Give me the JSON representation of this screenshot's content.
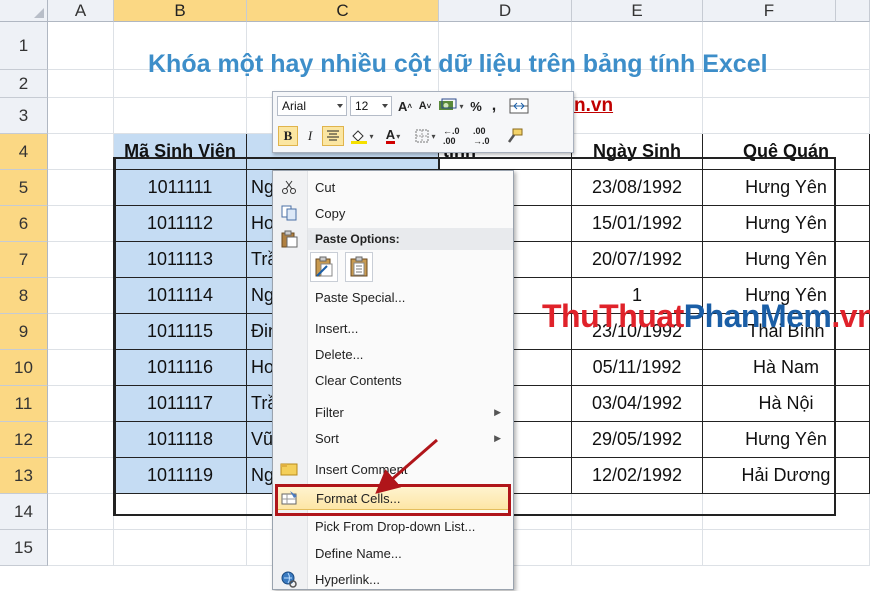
{
  "columns": [
    "A",
    "B",
    "C",
    "D",
    "E",
    "F"
  ],
  "rows": [
    "1",
    "2",
    "3",
    "4",
    "5",
    "6",
    "7",
    "8",
    "9",
    "10",
    "11",
    "12",
    "13",
    "14",
    "15"
  ],
  "title": "Khóa một hay nhiều cột dữ liệu trên bảng tính Excel",
  "subtitle_visible": "n.vn",
  "watermark": {
    "part1": "ThuThuat",
    "part2": "PhanMem",
    "part3": ".vn"
  },
  "headers": {
    "b": "Mã Sinh Viên",
    "d": "tính",
    "e": "Ngày Sinh",
    "f": "Quê Quán"
  },
  "data_rows": [
    {
      "b": "1011111",
      "c": "Ng",
      "e": "23/08/1992",
      "f": "Hưng Yên"
    },
    {
      "b": "1011112",
      "c": "Ho",
      "e": "15/01/1992",
      "f": "Hưng Yên"
    },
    {
      "b": "1011113",
      "c": "Trầ",
      "e": "20/07/1992",
      "f": "Hưng Yên"
    },
    {
      "b": "1011114",
      "c": "Ng",
      "e": "1",
      "f": "Hưng Yên"
    },
    {
      "b": "1011115",
      "c": "Đin",
      "e": "23/10/1992",
      "f": "Thái Bình"
    },
    {
      "b": "1011116",
      "c": "Ho",
      "e": "05/11/1992",
      "f": "Hà Nam"
    },
    {
      "b": "1011117",
      "c": "Trầ",
      "e": "03/04/1992",
      "f": "Hà Nội"
    },
    {
      "b": "1011118",
      "c": "Vũ",
      "e": "29/05/1992",
      "f": "Hưng Yên"
    },
    {
      "b": "1011119",
      "c": "Ng",
      "e": "12/02/1992",
      "f": "Hải Dương"
    }
  ],
  "mini_toolbar": {
    "font": "Arial",
    "size": "12",
    "percent": "%",
    "comma": ",",
    "bold": "B",
    "italic": "I",
    "font_color": "A",
    "inc_decimal": "←.0 .00",
    "dec_decimal": ".00 →.0"
  },
  "menu": {
    "cut": "Cut",
    "copy": "Copy",
    "paste_options": "Paste Options:",
    "paste_special": "Paste Special...",
    "insert": "Insert...",
    "delete": "Delete...",
    "clear_contents": "Clear Contents",
    "filter": "Filter",
    "sort": "Sort",
    "insert_comment": "Insert Comment",
    "format_cells": "Format Cells...",
    "pick_list": "Pick From Drop-down List...",
    "define_name": "Define Name...",
    "hyperlink": "Hyperlink..."
  },
  "colors": {
    "title": "#3d8ec9",
    "selection": "#c5dcf3",
    "highlight_box": "#b0151a",
    "watermark_red": "#e0222a",
    "watermark_blue": "#1a5ea6"
  }
}
